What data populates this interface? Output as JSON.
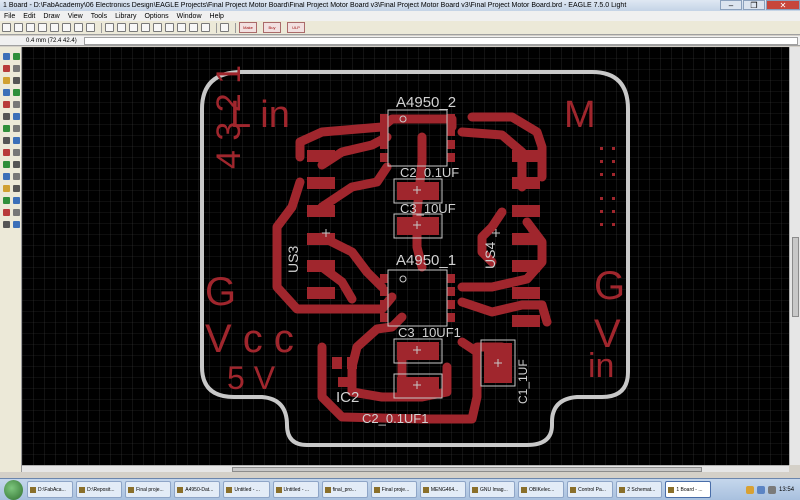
{
  "window": {
    "title": "1 Board - D:\\FabAcademy\\06 Electronics Design\\EAGLE Projects\\Final Project Motor Board\\Final Project Motor Board v3\\Final Project Motor Board v3\\Final Project Motor Board.brd - EAGLE 7.5.0 Light",
    "minimize": "–",
    "maximize": "❐",
    "close": "✕"
  },
  "menu": [
    "File",
    "Edit",
    "Draw",
    "View",
    "Tools",
    "Library",
    "Options",
    "Window",
    "Help"
  ],
  "toolbar": {
    "buttons": [
      "new-icon",
      "save-icon",
      "print-icon",
      "cam-icon",
      "upload-icon",
      "board-icon",
      "script-icon",
      "run-icon",
      "zoom-fit-icon",
      "zoom-in-icon",
      "zoom-out-icon",
      "zoom-redraw-icon",
      "zoom-select-icon",
      "undo-icon",
      "redo-icon",
      "stop-icon",
      "go-icon",
      "help-icon"
    ],
    "extra": [
      "Make",
      "Buy",
      "ULP"
    ]
  },
  "command": {
    "coordinate": "0.4 mm (72.4 42.4)",
    "value": ""
  },
  "board": {
    "labels": {
      "lin": "L in",
      "m": "M",
      "numbers": "4 3 2 1",
      "g_left": "G",
      "vcc": "V c c",
      "five_v": "5 V",
      "g_right": "G",
      "v_right": "V",
      "in_right": "in"
    },
    "parts": {
      "a4950_2": "A4950_2",
      "a4950_1": "A4950_1",
      "c2_top": "C2_0.1UF",
      "c3_top": "C3_10UF",
      "us3": "US3",
      "us4": "US4",
      "c3_bot": "C3_10UF1",
      "c1": "C1_1UF",
      "ic2": "IC2",
      "c2_bot": "C2_0.1UF1"
    },
    "colors": {
      "copper": "#a0262d",
      "outline": "#c8c8c8",
      "silk": "#c8c8c8",
      "label": "#a0262d"
    }
  },
  "taskbar": {
    "items": [
      "D:\\FabAca...",
      "D:\\Reposit...",
      "Final proje...",
      "A4950-Dat...",
      "Untitled - ...",
      "Untitled - ...",
      "final_pro...",
      "Final proje...",
      "MENG464...",
      "GNU Imag...",
      "OBIKelec...",
      "Control Pa...",
      "2 Schemat...",
      "1 Board - ..."
    ],
    "time": "13:54"
  }
}
